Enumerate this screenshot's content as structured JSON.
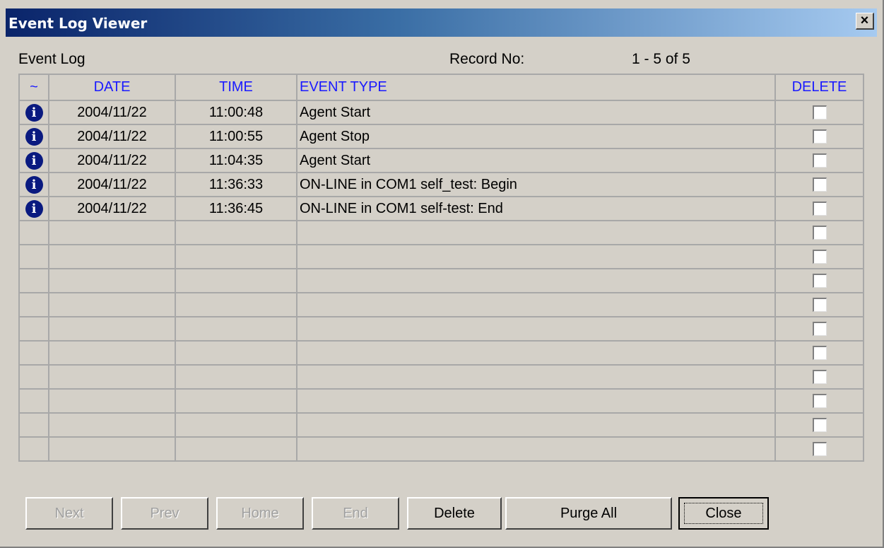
{
  "window": {
    "title": "Event Log Viewer",
    "close_glyph": "×"
  },
  "header": {
    "event_log_label": "Event Log",
    "record_label": "Record No:",
    "record_range": "1 - 5 of 5"
  },
  "columns": {
    "icon": "~",
    "date": "DATE",
    "time": "TIME",
    "event_type": "EVENT TYPE",
    "delete": "DELETE"
  },
  "rows": [
    {
      "icon": "info-icon",
      "date": "2004/11/22",
      "time": "11:00:48",
      "event_type": "Agent Start"
    },
    {
      "icon": "info-icon",
      "date": "2004/11/22",
      "time": "11:00:55",
      "event_type": "Agent Stop"
    },
    {
      "icon": "info-icon",
      "date": "2004/11/22",
      "time": "11:04:35",
      "event_type": "Agent Start"
    },
    {
      "icon": "info-icon",
      "date": "2004/11/22",
      "time": "11:36:33",
      "event_type": "ON-LINE in COM1 self_test: Begin"
    },
    {
      "icon": "info-icon",
      "date": "2004/11/22",
      "time": "11:36:45",
      "event_type": "ON-LINE in COM1 self-test: End"
    },
    {
      "icon": "",
      "date": "",
      "time": "",
      "event_type": ""
    },
    {
      "icon": "",
      "date": "",
      "time": "",
      "event_type": ""
    },
    {
      "icon": "",
      "date": "",
      "time": "",
      "event_type": ""
    },
    {
      "icon": "",
      "date": "",
      "time": "",
      "event_type": ""
    },
    {
      "icon": "",
      "date": "",
      "time": "",
      "event_type": ""
    },
    {
      "icon": "",
      "date": "",
      "time": "",
      "event_type": ""
    },
    {
      "icon": "",
      "date": "",
      "time": "",
      "event_type": ""
    },
    {
      "icon": "",
      "date": "",
      "time": "",
      "event_type": ""
    },
    {
      "icon": "",
      "date": "",
      "time": "",
      "event_type": ""
    },
    {
      "icon": "",
      "date": "",
      "time": "",
      "event_type": ""
    }
  ],
  "buttons": {
    "next": "Next",
    "prev": "Prev",
    "home": "Home",
    "end": "End",
    "delete": "Delete",
    "purge_all": "Purge All",
    "close": "Close"
  },
  "colors": {
    "title_gradient_start": "#0a246a",
    "title_gradient_end": "#a6caf0",
    "header_text": "#1a1aff",
    "window_bg": "#d4d0c8"
  }
}
